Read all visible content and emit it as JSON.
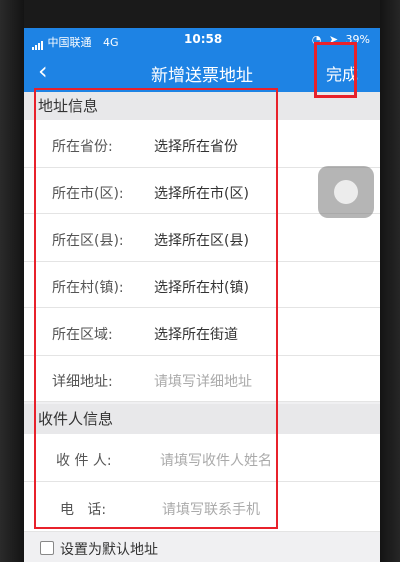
{
  "status_bar": {
    "carrier": "中国联通",
    "network": "4G",
    "time": "10:58",
    "battery": "39%"
  },
  "nav": {
    "title": "新增送票地址",
    "done_label": "完成"
  },
  "address_section": {
    "title": "地址信息",
    "rows": [
      {
        "label": "所在省份:",
        "value": "选择所在省份"
      },
      {
        "label": "所在市(区):",
        "value": "选择所在市(区)"
      },
      {
        "label": "所在区(县):",
        "value": "选择所在区(县)"
      },
      {
        "label": "所在村(镇):",
        "value": "选择所在村(镇)"
      },
      {
        "label": "所在区域:",
        "value": "选择所在街道"
      },
      {
        "label": "详细地址:",
        "placeholder": "请填写详细地址"
      }
    ]
  },
  "recipient_section": {
    "title": "收件人信息",
    "rows": [
      {
        "label": "收 件 人:",
        "placeholder": "请填写收件人姓名"
      },
      {
        "label": "电   话:",
        "placeholder": "请填写联系手机"
      }
    ]
  },
  "default_address": {
    "label": "设置为默认地址",
    "checked": false
  },
  "colors": {
    "primary": "#1e83e4",
    "highlight": "#e8212b"
  }
}
